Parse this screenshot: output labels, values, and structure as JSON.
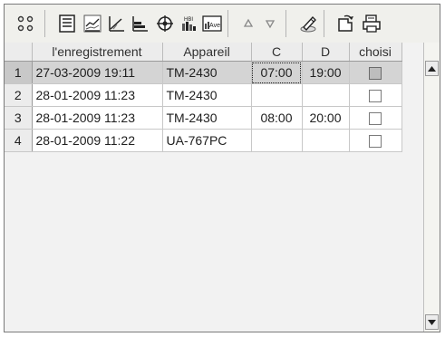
{
  "toolbar": {
    "buttons": [
      {
        "icon": "view-grid-icon"
      },
      {
        "icon": "table-list-icon"
      },
      {
        "icon": "line-chart-icon"
      },
      {
        "icon": "trend-chart-icon"
      },
      {
        "icon": "bar-chart-icon"
      },
      {
        "icon": "target-icon"
      },
      {
        "icon": "histogram-icon"
      },
      {
        "icon": "average-chart-icon"
      },
      {
        "icon": "sort-up-icon"
      },
      {
        "icon": "sort-down-icon"
      },
      {
        "icon": "edit-pen-icon"
      },
      {
        "icon": "open-device-icon"
      },
      {
        "icon": "print-icon"
      }
    ],
    "hbi_label": "HBI",
    "ave_label": "Ave"
  },
  "table": {
    "columns": [
      "",
      "l'enregistrement",
      "Appareil",
      "C",
      "D",
      "choisi"
    ],
    "rows": [
      {
        "num": "1",
        "date": "27-03-2009 19:11",
        "device": "TM-2430",
        "c": "07:00",
        "d": "19:00",
        "checked": true,
        "selected": true
      },
      {
        "num": "2",
        "date": "28-01-2009 11:23",
        "device": "TM-2430",
        "c": "",
        "d": "",
        "checked": false,
        "selected": false
      },
      {
        "num": "3",
        "date": "28-01-2009 11:23",
        "device": "TM-2430",
        "c": "08:00",
        "d": "20:00",
        "checked": false,
        "selected": false
      },
      {
        "num": "4",
        "date": "28-01-2009 11:22",
        "device": "UA-767PC",
        "c": "",
        "d": "",
        "checked": false,
        "selected": false
      }
    ]
  },
  "colors": {
    "selected_row": "#d4d4d4",
    "header_bg": "#ececec",
    "background": "#f2f2f2"
  }
}
